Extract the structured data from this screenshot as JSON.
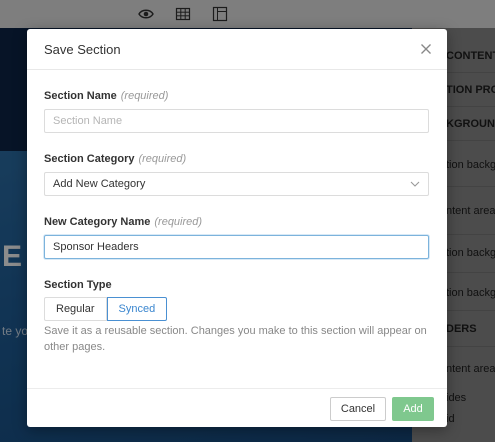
{
  "background": {
    "hero_letter": "E",
    "side_text": "te yo",
    "panel_rows": [
      "CONTENT",
      "TION PROP",
      "KGROUND",
      "tion backgr",
      "ntent area b",
      "tion backgr",
      "tion backgr",
      "DERS",
      "ntent area b",
      "ides",
      "id"
    ]
  },
  "modal": {
    "title": "Save Section",
    "section_name": {
      "label": "Section Name",
      "required": "(required)",
      "placeholder": "Section Name",
      "value": ""
    },
    "section_category": {
      "label": "Section Category",
      "required": "(required)",
      "selected": "Add New Category"
    },
    "new_category": {
      "label": "New Category Name",
      "required": "(required)",
      "value": "Sponsor Headers"
    },
    "section_type": {
      "label": "Section Type",
      "options": [
        "Regular",
        "Synced"
      ],
      "selected": "Synced",
      "help": "Save it as a reusable section. Changes you make to this section will appear on other pages."
    },
    "footer": {
      "cancel": "Cancel",
      "add": "Add"
    }
  },
  "colors": {
    "accent": "#4a90d2",
    "add_button": "#7fc88e",
    "overlay": "#000000"
  }
}
